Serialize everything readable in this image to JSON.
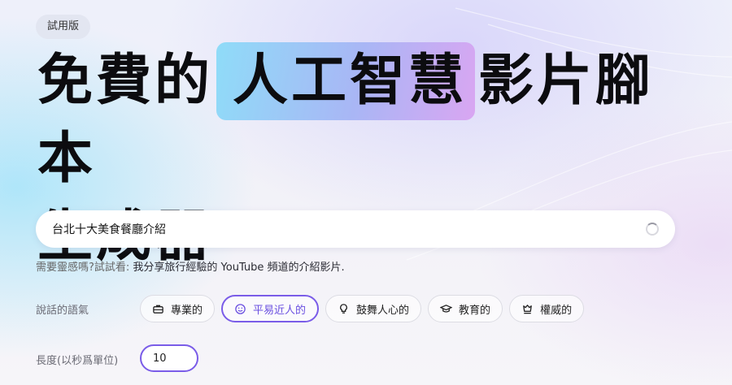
{
  "badge": "試用版",
  "headline": {
    "part1": "免費的",
    "highlight": "人工智慧",
    "part2": "影片腳本",
    "line2": "生成器"
  },
  "search": {
    "value": "台北十大美食餐廳介紹",
    "placeholder": ""
  },
  "hint": {
    "prefix": "需要靈感嗎?試試看:",
    "example": "我分享旅行經驗的 YouTube 頻道的介紹影片."
  },
  "tone": {
    "label": "說話的語氣",
    "options": [
      {
        "label": "專業的",
        "icon": "briefcase-icon"
      },
      {
        "label": "平易近人的",
        "icon": "smile-icon"
      },
      {
        "label": "鼓舞人心的",
        "icon": "lightbulb-icon"
      },
      {
        "label": "教育的",
        "icon": "graduation-cap-icon"
      },
      {
        "label": "權威的",
        "icon": "chess-piece-icon"
      }
    ],
    "selected": "平易近人的"
  },
  "length": {
    "label": "長度(以秒爲單位)",
    "value": "10"
  },
  "colors": {
    "accent": "#7a5ce8"
  }
}
